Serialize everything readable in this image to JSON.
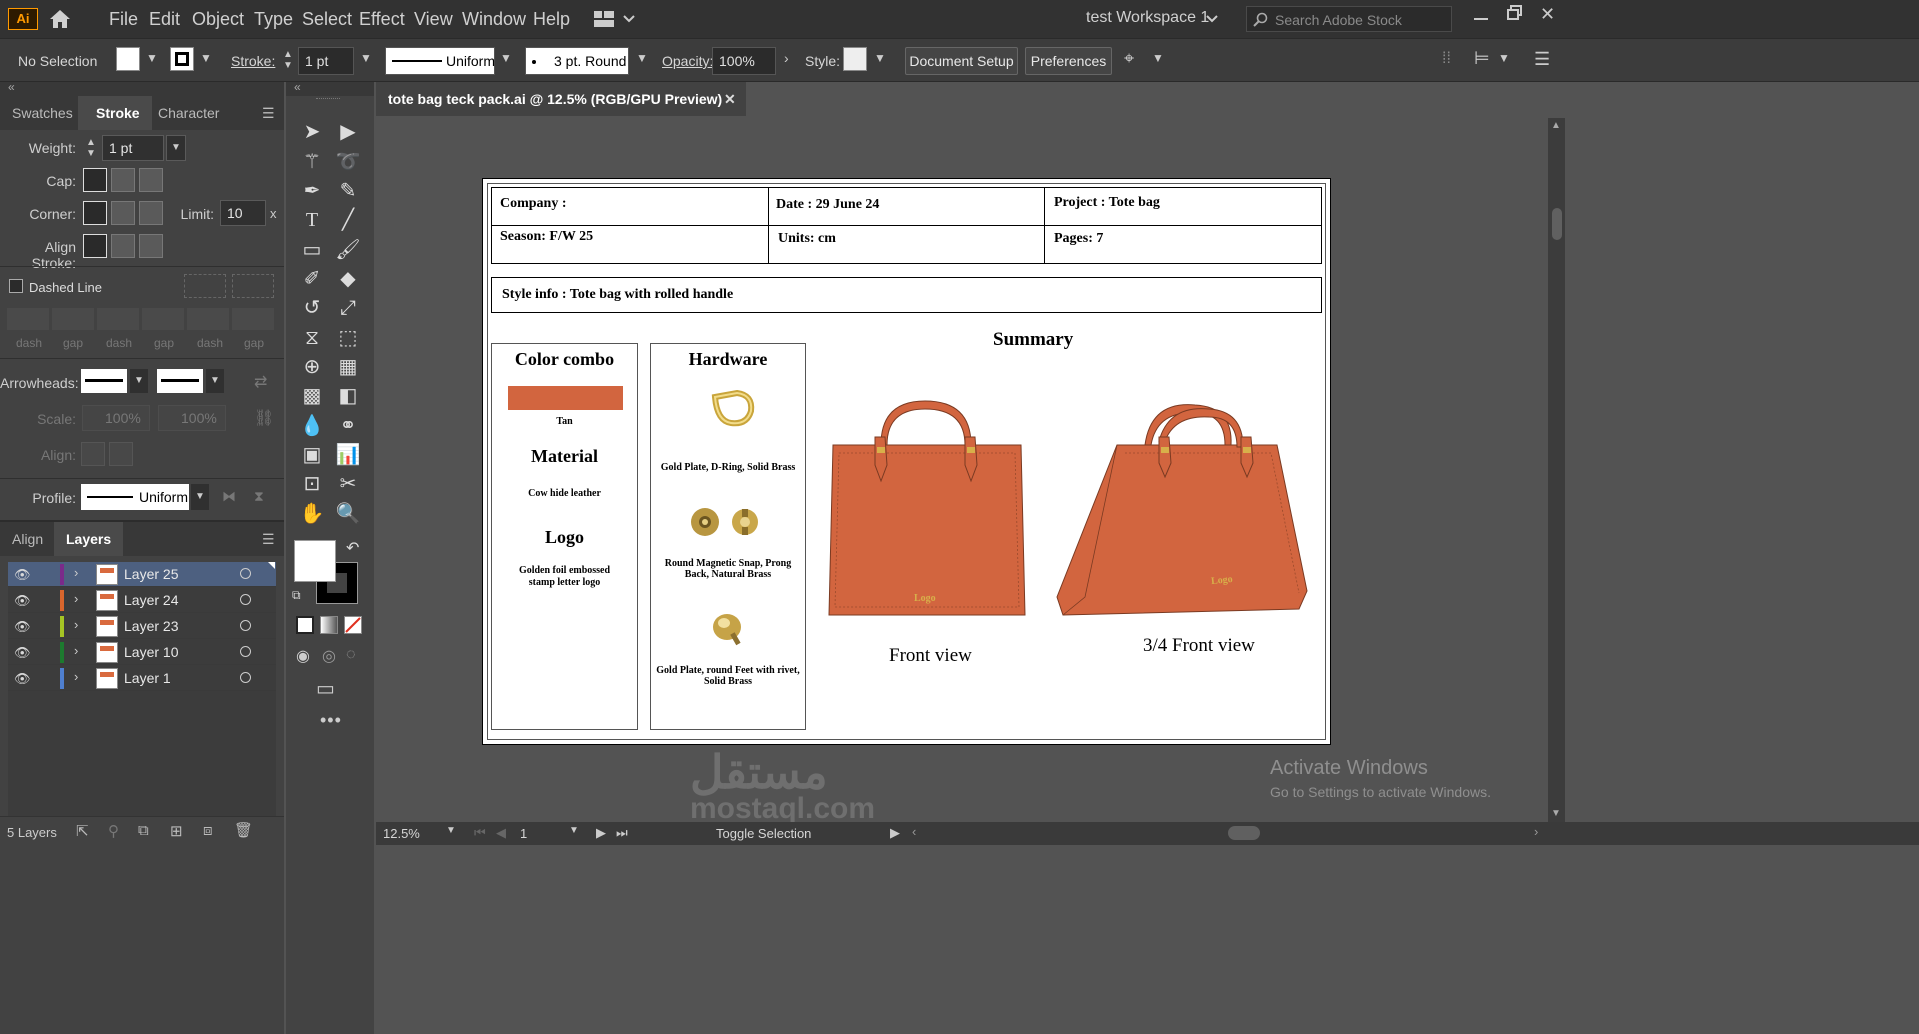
{
  "app": {
    "logo": "Ai"
  },
  "menu": [
    "File",
    "Edit",
    "Object",
    "Type",
    "Select",
    "Effect",
    "View",
    "Window",
    "Help"
  ],
  "workspace": {
    "name": "test Workspace 1",
    "search_placeholder": "Search Adobe Stock"
  },
  "control": {
    "selection": "No Selection",
    "stroke_label": "Stroke:",
    "stroke_value": "1 pt",
    "profile": "Uniform",
    "brush": "3 pt. Round",
    "opacity_label": "Opacity:",
    "opacity_value": "100%",
    "style_label": "Style:",
    "doc_setup": "Document Setup",
    "preferences": "Preferences"
  },
  "stroke_panel": {
    "tabs": [
      "Swatches",
      "Stroke",
      "Character"
    ],
    "weight_label": "Weight:",
    "weight_value": "1 pt",
    "cap_label": "Cap:",
    "corner_label": "Corner:",
    "limit_label": "Limit:",
    "limit_value": "10",
    "limit_unit": "x",
    "align_label": "Align Stroke:",
    "dashed_label": "Dashed Line",
    "dash_labels": [
      "dash",
      "gap",
      "dash",
      "gap",
      "dash",
      "gap"
    ],
    "arrowheads_label": "Arrowheads:",
    "scale_label": "Scale:",
    "scale_a": "100%",
    "scale_b": "100%",
    "align2_label": "Align:",
    "profile_label": "Profile:",
    "profile_value": "Uniform"
  },
  "layers_panel": {
    "tabs": [
      "Align",
      "Layers"
    ],
    "layers": [
      {
        "name": "Layer 25",
        "color": "#7b2a8a",
        "selected": true
      },
      {
        "name": "Layer 24",
        "color": "#d9662d",
        "selected": false
      },
      {
        "name": "Layer 23",
        "color": "#a5c424",
        "selected": false
      },
      {
        "name": "Layer 10",
        "color": "#1d7a2f",
        "selected": false
      },
      {
        "name": "Layer 1",
        "color": "#4f7fcf",
        "selected": false
      }
    ],
    "count": "5 Layers"
  },
  "document": {
    "tab_title": "tote bag teck pack.ai @ 12.5% (RGB/GPU Preview)",
    "header": {
      "company": "Company :",
      "date": "Date : 29 June 24",
      "project": "Project : Tote bag",
      "season": "Season: F/W 25",
      "units": "Units: cm",
      "pages": "Pages: 7"
    },
    "style_info": "Style info : Tote bag with rolled handle",
    "color_combo_title": "Color combo",
    "color_name": "Tan",
    "material_title": "Material",
    "material_text": "Cow hide leather",
    "logo_title": "Logo",
    "logo_text": "Golden foil embossed stamp letter logo",
    "hardware_title": "Hardware",
    "hardware_items": [
      "Gold Plate, D-Ring, Solid Brass",
      "Round Magnetic Snap, Prong Back, Natural Brass",
      "Gold Plate, round Feet with rivet, Solid Brass"
    ],
    "summary_title": "Summary",
    "bag_logo": "Logo",
    "front_label": "Front view",
    "three_quarter_label": "3/4 Front view",
    "bag_color": "#d2653f"
  },
  "status": {
    "zoom": "12.5%",
    "page": "1",
    "toggle": "Toggle Selection"
  },
  "watermark": {
    "title": "Activate Windows",
    "subtitle": "Go to Settings to activate Windows.",
    "brand_ar": "مستقل",
    "brand": "mostaql.com"
  }
}
